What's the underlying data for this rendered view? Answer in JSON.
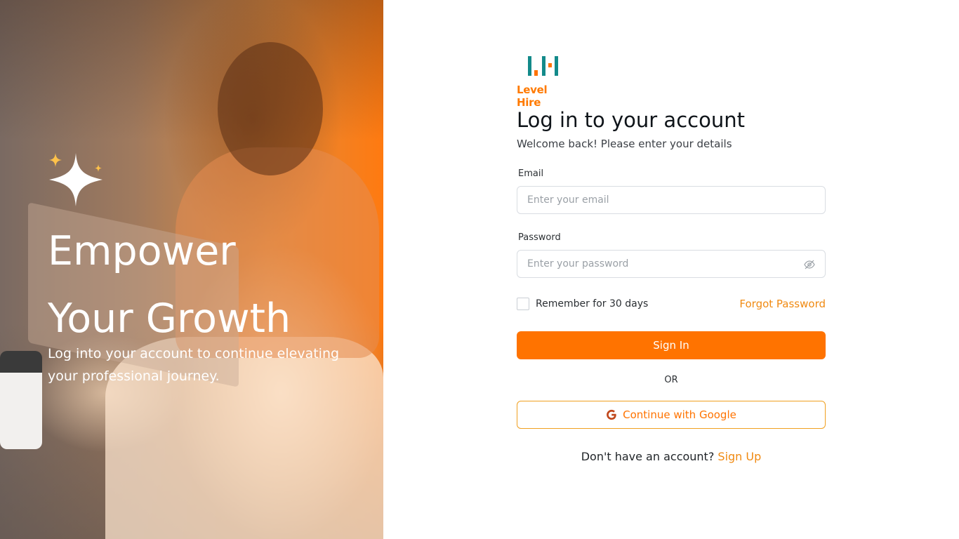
{
  "hero": {
    "title_line1": "Empower",
    "title_line2": "Your Growth",
    "subtitle": "Log into your account to continue elevating your professional journey."
  },
  "brand": {
    "name": "Level Hire",
    "accent": "#ff7300",
    "logo_teal": "#138a8a"
  },
  "form": {
    "title": "Log in to your account",
    "subtitle": "Welcome back! Please enter your details",
    "email_label": "Email",
    "email_placeholder": "Enter your email",
    "email_value": "",
    "password_label": "Password",
    "password_placeholder": "Enter your password",
    "password_value": "",
    "remember_label": "Remember for 30 days",
    "remember_checked": false,
    "forgot_label": "Forgot Password",
    "signin_label": "Sign In",
    "or_label": "OR",
    "google_label": "Continue with Google",
    "signup_prompt": "Don't have an account?",
    "signup_link": "Sign Up"
  },
  "icons": {
    "sparkle": "sparkle-icon",
    "eye": "eye-off-icon",
    "google": "google-icon"
  }
}
